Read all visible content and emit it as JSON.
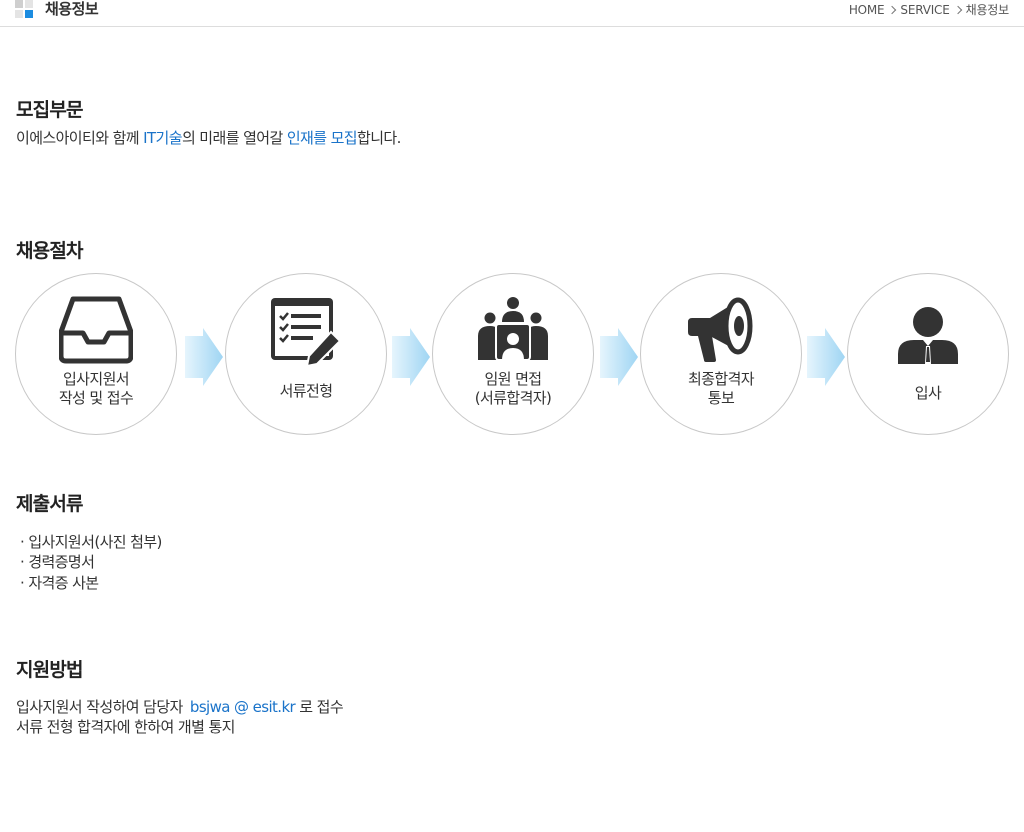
{
  "header": {
    "title": "채용정보",
    "breadcrumb": [
      "HOME",
      "SERVICE",
      "채용정보"
    ]
  },
  "recruit_field": {
    "title": "모집부문",
    "text_before": "이에스아이티와 함께 ",
    "text_accent1": "IT기술",
    "text_middle": "의 미래를 열어갈 ",
    "text_accent2": "인재를 모집",
    "text_after": "합니다."
  },
  "process": {
    "title": "채용절차",
    "steps": [
      {
        "line1": "입사지원서",
        "line2": "작성 및 접수",
        "icon": "inbox-tray-icon"
      },
      {
        "line1": "서류전형",
        "line2": "",
        "icon": "document-edit-icon"
      },
      {
        "line1": "임원 면접",
        "line2": "(서류합격자)",
        "icon": "meeting-icon"
      },
      {
        "line1": "최종합격자",
        "line2": "통보",
        "icon": "megaphone-icon"
      },
      {
        "line1": "입사",
        "line2": "",
        "icon": "person-icon"
      }
    ]
  },
  "documents": {
    "title": "제출서류",
    "items": [
      "· 입사지원서(사진 첨부)",
      "· 경력증명서",
      "· 자격증 사본"
    ]
  },
  "apply": {
    "title": "지원방법",
    "line1_before": "입사지원서 작성하여 담당자 ",
    "email": "bsjwa @ esit.kr",
    "line1_after": " 로 접수",
    "line2": "서류 전형 합격자에 한하여 개별 통지"
  },
  "colors": {
    "accent": "#1a73c9",
    "icon": "#333333",
    "circle_border": "#c8c8c8",
    "arrow": "#a9dbf5",
    "logo_gray": "#cfcfcf",
    "logo_blue": "#1c8ce0"
  }
}
